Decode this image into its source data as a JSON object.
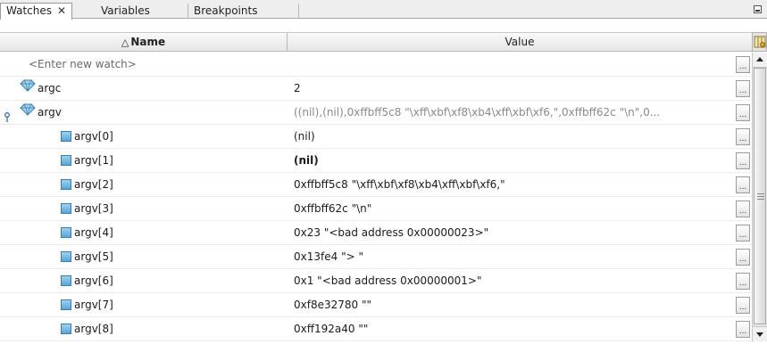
{
  "tabs": [
    {
      "label": "Watches",
      "close": "✕",
      "active": true
    },
    {
      "label": "Variables",
      "active": false
    },
    {
      "label": "Breakpoints",
      "active": false
    }
  ],
  "columns": {
    "name": "Name",
    "name_sort_indicator": "△",
    "value": "Value"
  },
  "new_watch_placeholder": "<Enter new watch>",
  "rows": [
    {
      "name": "argc",
      "value": "2",
      "icon": "watch-diamond-icon"
    },
    {
      "name": "argv",
      "value": "((nil),(nil),0xffbff5c8 \"\\xff\\xbf\\xf8\\xb4\\xff\\xbf\\xf6,\",0xffbff62c \"\\n\",0...",
      "icon": "watch-diamond-icon",
      "expanded": true
    },
    {
      "name": "argv[0]",
      "value": "(nil)",
      "icon": "field-square-icon"
    },
    {
      "name": "argv[1]",
      "value": "(nil)",
      "icon": "field-square-icon",
      "changed": true
    },
    {
      "name": "argv[2]",
      "value": "0xffbff5c8 \"\\xff\\xbf\\xf8\\xb4\\xff\\xbf\\xf6,\"",
      "icon": "field-square-icon"
    },
    {
      "name": "argv[3]",
      "value": "0xffbff62c \"\\n\"",
      "icon": "field-square-icon"
    },
    {
      "name": "argv[4]",
      "value": "0x23 \"<bad address 0x00000023>\"",
      "icon": "field-square-icon"
    },
    {
      "name": "argv[5]",
      "value": "0x13fe4 \"> \"",
      "icon": "field-square-icon"
    },
    {
      "name": "argv[6]",
      "value": "0x1 \"<bad address 0x00000001>\"",
      "icon": "field-square-icon"
    },
    {
      "name": "argv[7]",
      "value": "0xf8e32780 \"\"",
      "icon": "field-square-icon"
    },
    {
      "name": "argv[8]",
      "value": "0xff192a40 \"\"",
      "icon": "field-square-icon"
    }
  ],
  "cell_button_label": "...",
  "colors": {
    "header_bg": "#e6e6e6",
    "icon_blue": "#5aa6d6",
    "muted_value": "#8a8a8a"
  }
}
